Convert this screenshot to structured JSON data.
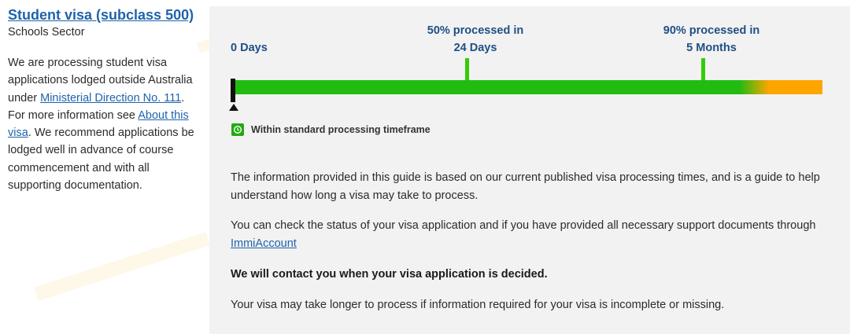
{
  "visa": {
    "title": "Student visa (subclass 500)",
    "sector": "Schools Sector",
    "desc_part1": "We are processing student visa applications lodged outside Australia under ",
    "link_ministerial": "Ministerial Direction No. 111",
    "desc_part2": ". For more information see ",
    "link_about": "About this visa",
    "desc_part3": ". We recommend applications be lodged well in advance of course commencement and with all supporting documentation."
  },
  "timeline": {
    "start_label": "0 Days",
    "milestone_50_line1": "50% processed in",
    "milestone_50_line2": "24 Days",
    "milestone_90_line1": "90% processed in",
    "milestone_90_line2": "5 Months",
    "status_text": "Within standard processing timeframe",
    "status_icon": "clock-icon",
    "colors": {
      "bar_green": "#22bb11",
      "bar_orange": "#ffa500",
      "link": "#1f63ab"
    }
  },
  "info": {
    "p1": "The information provided in this guide is based on our current published visa processing times, and is a guide to help understand how long a visa may take to process.",
    "p2_part1": "You can check the status of your visa application and if you have provided all necessary support documents through ",
    "p2_link": "ImmiAccount",
    "p3": "We will contact you when your visa application is decided.",
    "p4": "Your visa may take longer to process if information required for your visa is incomplete or missing."
  }
}
